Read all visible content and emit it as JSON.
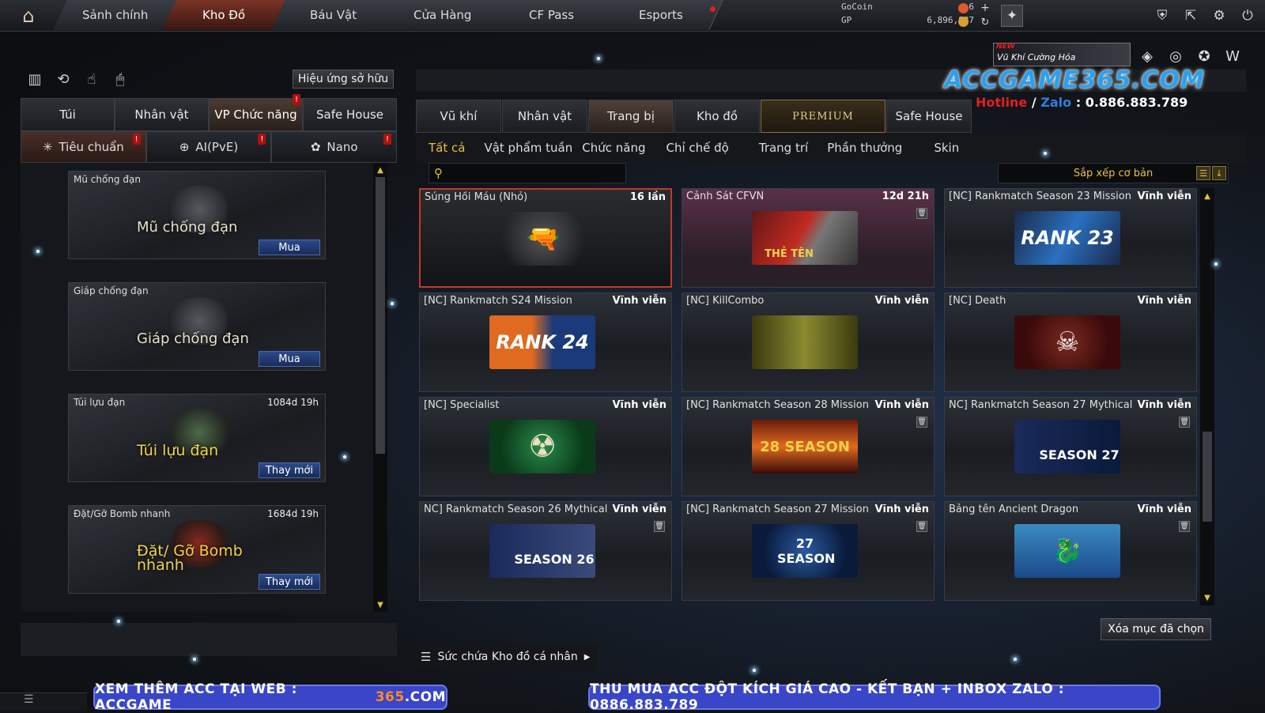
{
  "topnav": {
    "tabs": [
      "Sảnh chính",
      "Kho Đồ",
      "Báu Vật",
      "Cửa Hàng",
      "CF Pass",
      "Esports"
    ],
    "active": "Kho Đồ"
  },
  "currency": {
    "gocoin_label": "GoCoin",
    "gocoin_value": "6",
    "gp_label": "GP",
    "gp_value": "6,896,887"
  },
  "left": {
    "effect_button": "Hiệu ứng sở hữu",
    "tabs": [
      "Túi",
      "Nhân vật",
      "VP Chức năng",
      "Safe House"
    ],
    "active_tab": "VP Chức năng",
    "subtabs": [
      "Tiêu chuẩn",
      "AI(PvE)",
      "Nano"
    ],
    "items": [
      {
        "name": "Mũ chống đạn",
        "time": "",
        "big": "Mũ chống đạn",
        "button": "Mua"
      },
      {
        "name": "Giáp chống đạn",
        "time": "",
        "big": "Giáp chống đạn",
        "button": "Mua"
      },
      {
        "name": "Túi lựu đạn",
        "time": "1084d 19h",
        "big": "Túi lựu đạn",
        "button": "Thay mới"
      },
      {
        "name": "Đặt/Gỡ Bomb nhanh",
        "time": "1684d 19h",
        "big": "Đặt/ Gỡ Bomb nhanh",
        "button": "Thay mới"
      }
    ]
  },
  "right": {
    "tabs": [
      "Vũ khí",
      "Nhân vật",
      "Trang bị",
      "Kho đồ",
      "PREMIUM",
      "Safe House"
    ],
    "active_tab": "Trang bị",
    "subtabs": [
      "Tất cả",
      "Vật phẩm tuần",
      "Chức năng",
      "Chỉ chế độ",
      "Trang trí",
      "Phần thưởng",
      "Skin"
    ],
    "active_subtab": "Tất cả",
    "sort_label": "Sắp xếp cơ bản",
    "cards": [
      {
        "name": "Súng Hồi Máu (Nhỏ)",
        "time": "16 lần",
        "art": ""
      },
      {
        "name": "Cảnh Sát CFVN",
        "time": "12d 21h",
        "art": "THẺ TÊN"
      },
      {
        "name": "[NC] Rankmatch Season 23 Mission",
        "time": "Vĩnh viễn",
        "art": "RANK 23"
      },
      {
        "name": "[NC] Rankmatch S24 Mission",
        "time": "Vĩnh viễn",
        "art": "RANK 24"
      },
      {
        "name": "[NC] KillCombo",
        "time": "Vĩnh viễn",
        "art": ""
      },
      {
        "name": "[NC] Death",
        "time": "Vĩnh viễn",
        "art": ""
      },
      {
        "name": "[NC] Specialist",
        "time": "Vĩnh viễn",
        "art": ""
      },
      {
        "name": "[NC] Rankmatch Season 28 Mission",
        "time": "Vĩnh viễn",
        "art": "28 SEASON"
      },
      {
        "name": "NC] Rankmatch Season 27 Mythical",
        "time": "Vĩnh viễn",
        "art": "SEASON 27"
      },
      {
        "name": "NC] Rankmatch Season 26 Mythical",
        "time": "Vĩnh viễn",
        "art": "SEASON 26"
      },
      {
        "name": "[NC] Rankmatch Season 27 Mission",
        "time": "Vĩnh viễn",
        "art": "27 SEASON"
      },
      {
        "name": "Bảng tên Ancient Dragon",
        "time": "Vĩnh viễn",
        "art": ""
      }
    ],
    "delete_button": "Xóa mục đã chọn",
    "capacity_label": "Sức chứa Kho đồ cá nhân"
  },
  "watermark": {
    "logo": "ACCGAME365.COM",
    "hotline_label": "Hotline",
    "zalo_label": "Zalo",
    "phone": "0.886.883.789",
    "new_badge": "NEW",
    "new_text": "Vũ Khí Cường Hóa",
    "banner_left_a": "XEM THÊM ACC TẠI WEB : ACCGAME",
    "banner_left_b": "365",
    "banner_left_c": ".COM",
    "banner_right": "THU MUA ACC ĐỘT KÍCH GIÁ CAO - KẾT BẠN + INBOX ZALO : 0886.883.789"
  },
  "colors": {
    "accent_gold": "#e8c040",
    "selected_border": "#c03a28",
    "buy_button": "#2c4a8c"
  }
}
